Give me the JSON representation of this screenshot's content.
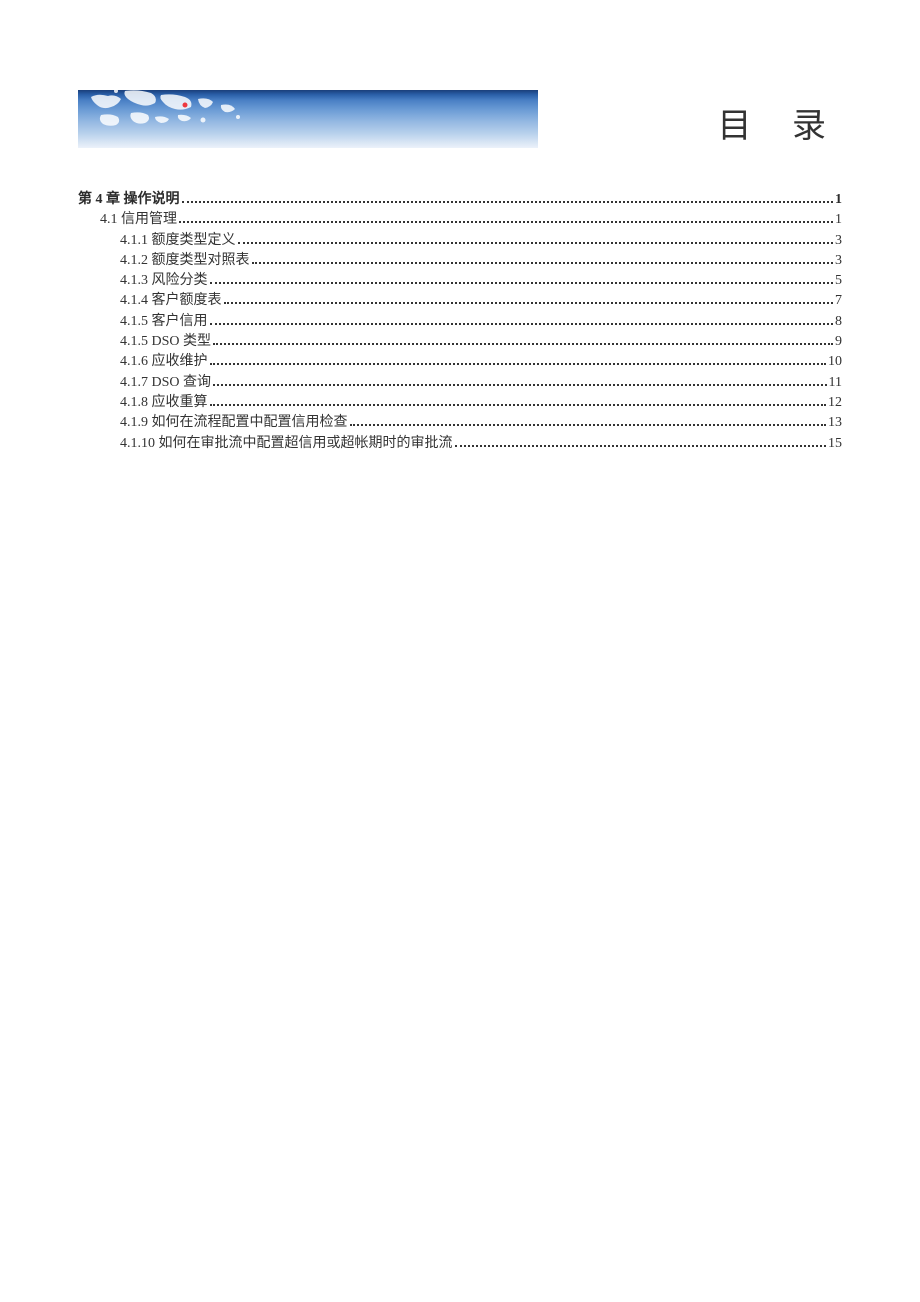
{
  "title": "目 录",
  "toc": {
    "entries": [
      {
        "level": 0,
        "label": "第 4 章  操作说明",
        "page": "1"
      },
      {
        "level": 1,
        "label": "4.1 信用管理",
        "page": "1"
      },
      {
        "level": 2,
        "label": "4.1.1 额度类型定义",
        "page": "3"
      },
      {
        "level": 2,
        "label": "4.1.2 额度类型对照表",
        "page": "3"
      },
      {
        "level": 2,
        "label": "4.1.3 风险分类",
        "page": "5"
      },
      {
        "level": 2,
        "label": "4.1.4 客户额度表",
        "page": "7"
      },
      {
        "level": 2,
        "label": "4.1.5 客户信用",
        "page": "8"
      },
      {
        "level": 2,
        "label": "4.1.5 DSO 类型",
        "page": "9"
      },
      {
        "level": 2,
        "label": "4.1.6 应收维护",
        "page": "10"
      },
      {
        "level": 2,
        "label": "4.1.7 DSO 查询",
        "page": "11"
      },
      {
        "level": 2,
        "label": "4.1.8 应收重算",
        "page": "12"
      },
      {
        "level": 2,
        "label": "4.1.9 如何在流程配置中配置信用检查",
        "page": "13"
      },
      {
        "level": 2,
        "label": "4.1.10 如何在审批流中配置超信用或超帐期时的审批流",
        "page": "15"
      }
    ]
  }
}
